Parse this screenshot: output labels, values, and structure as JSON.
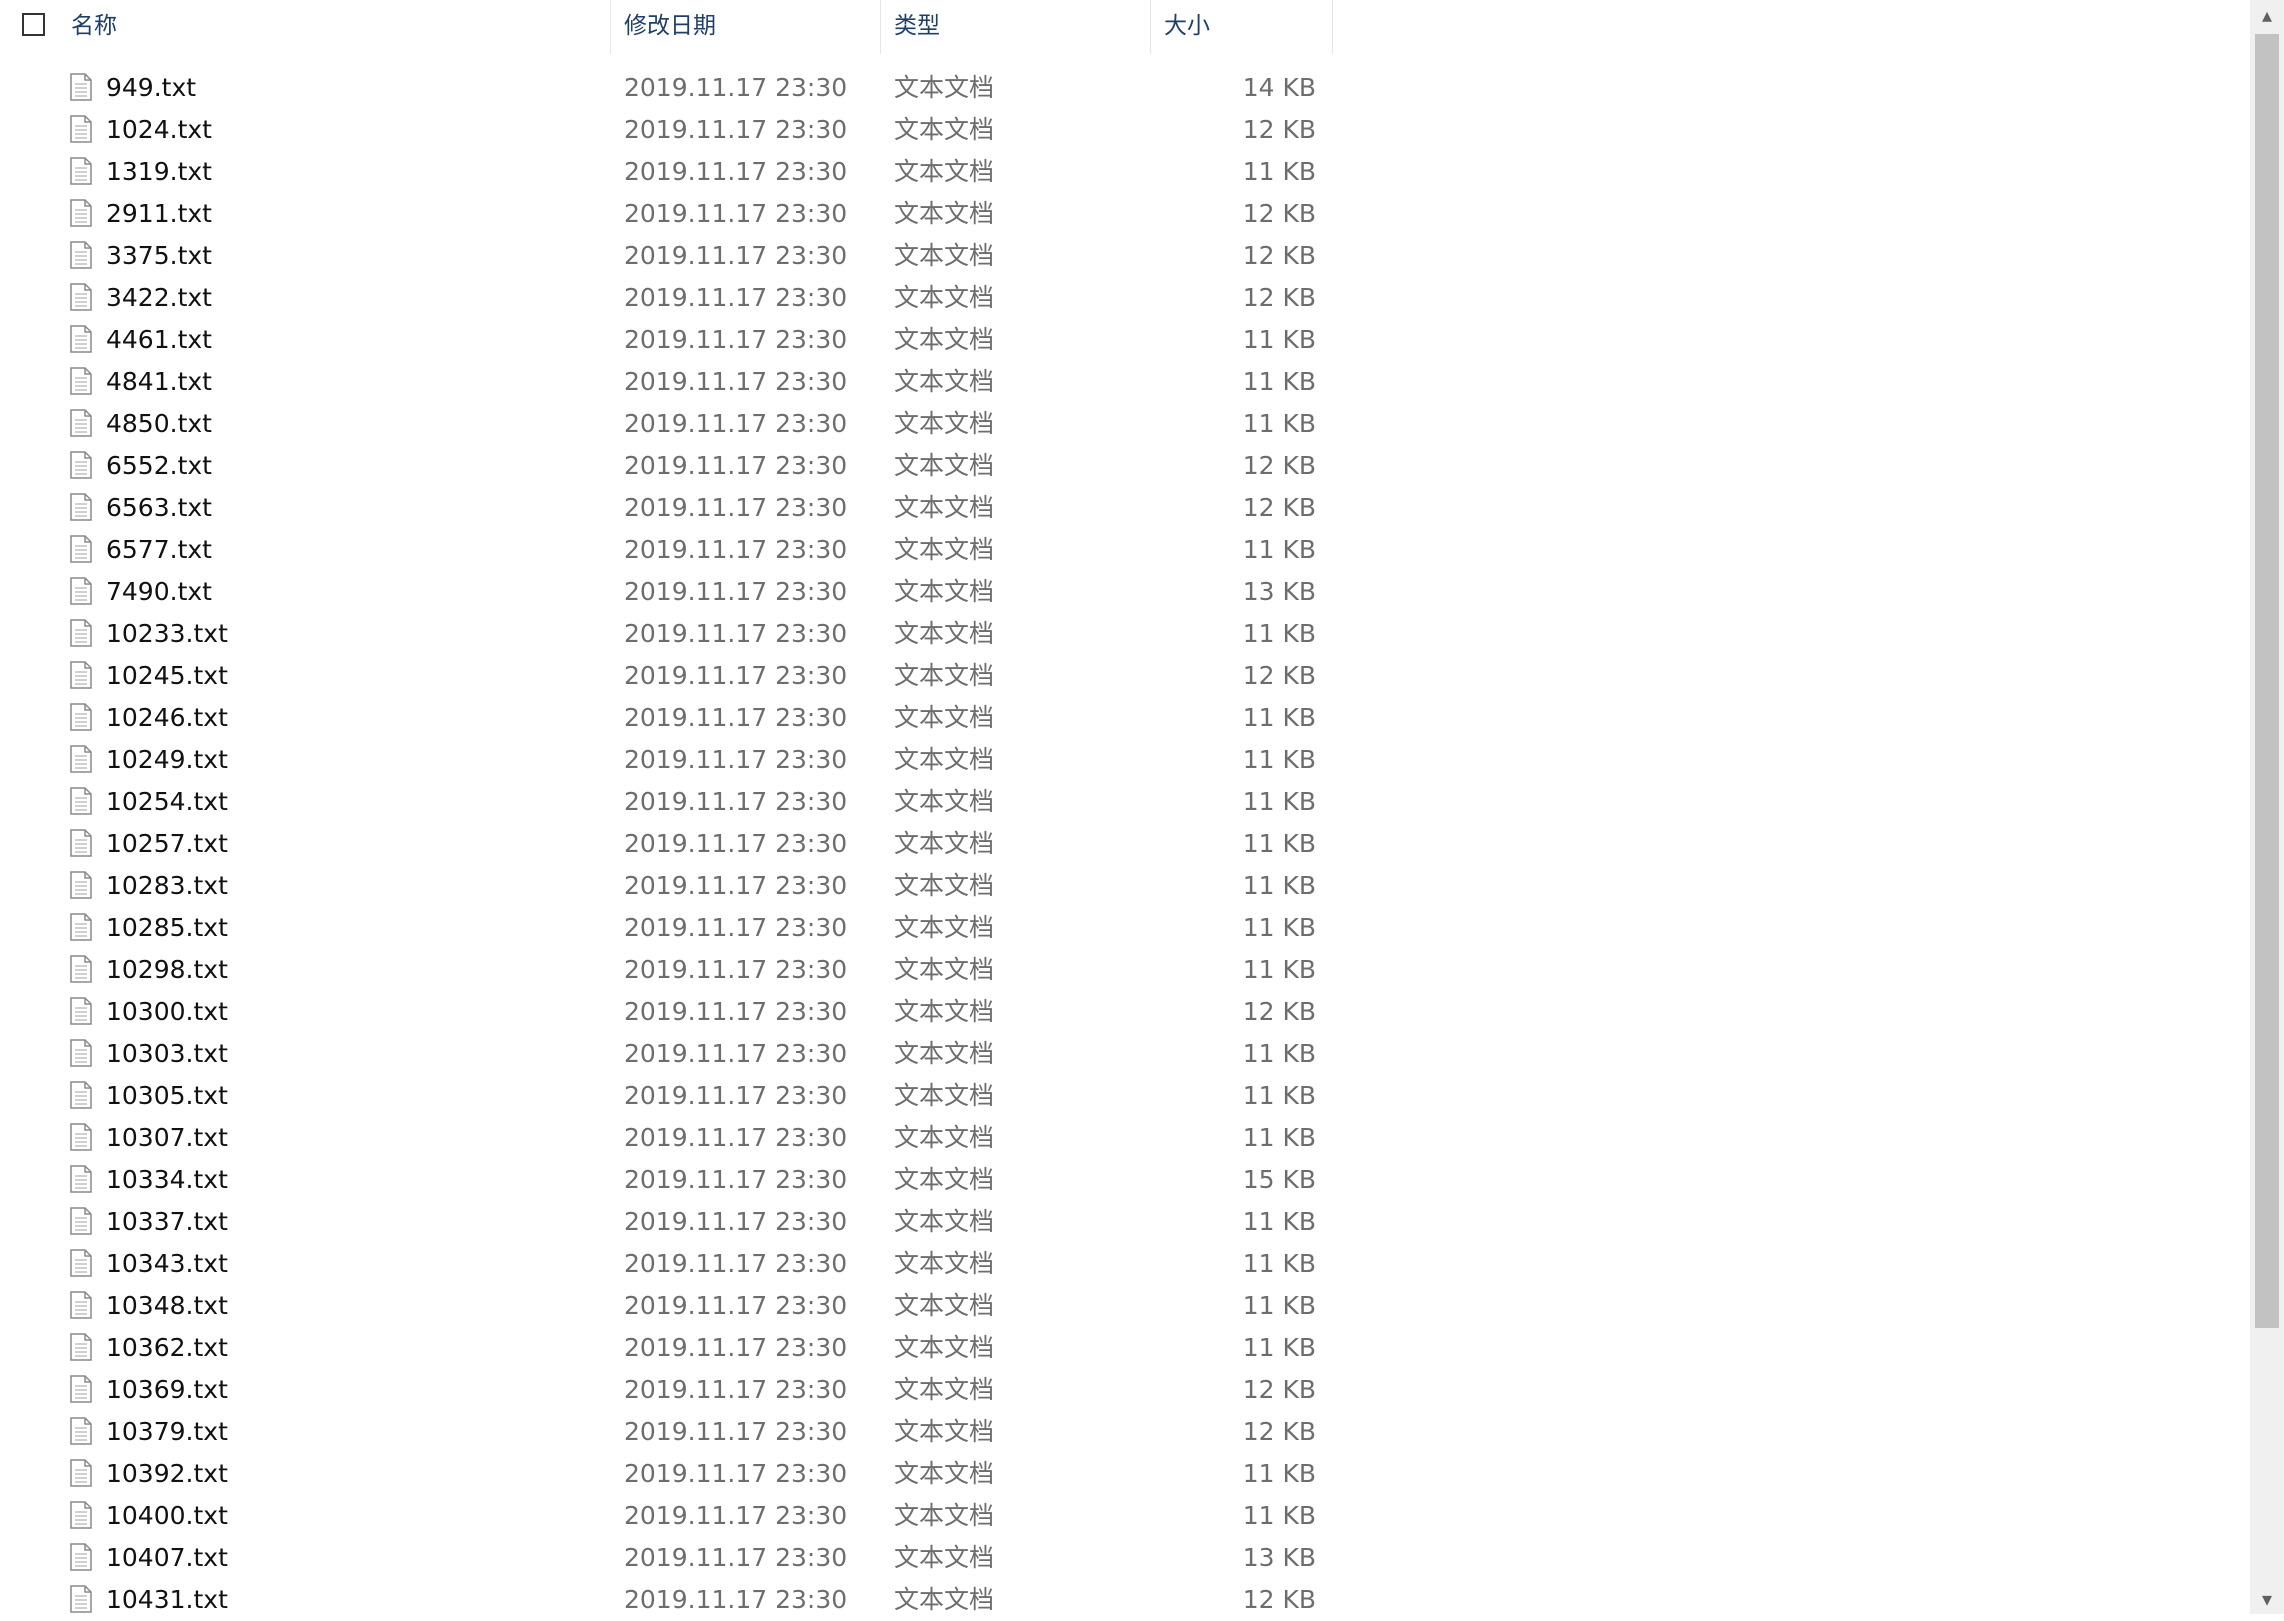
{
  "header": {
    "name": "名称",
    "date": "修改日期",
    "type": "类型",
    "size": "大小"
  },
  "files": [
    {
      "name": "949.txt",
      "date": "2019.11.17 23:30",
      "type": "文本文档",
      "size": "14 KB"
    },
    {
      "name": "1024.txt",
      "date": "2019.11.17 23:30",
      "type": "文本文档",
      "size": "12 KB"
    },
    {
      "name": "1319.txt",
      "date": "2019.11.17 23:30",
      "type": "文本文档",
      "size": "11 KB"
    },
    {
      "name": "2911.txt",
      "date": "2019.11.17 23:30",
      "type": "文本文档",
      "size": "12 KB"
    },
    {
      "name": "3375.txt",
      "date": "2019.11.17 23:30",
      "type": "文本文档",
      "size": "12 KB"
    },
    {
      "name": "3422.txt",
      "date": "2019.11.17 23:30",
      "type": "文本文档",
      "size": "12 KB"
    },
    {
      "name": "4461.txt",
      "date": "2019.11.17 23:30",
      "type": "文本文档",
      "size": "11 KB"
    },
    {
      "name": "4841.txt",
      "date": "2019.11.17 23:30",
      "type": "文本文档",
      "size": "11 KB"
    },
    {
      "name": "4850.txt",
      "date": "2019.11.17 23:30",
      "type": "文本文档",
      "size": "11 KB"
    },
    {
      "name": "6552.txt",
      "date": "2019.11.17 23:30",
      "type": "文本文档",
      "size": "12 KB"
    },
    {
      "name": "6563.txt",
      "date": "2019.11.17 23:30",
      "type": "文本文档",
      "size": "12 KB"
    },
    {
      "name": "6577.txt",
      "date": "2019.11.17 23:30",
      "type": "文本文档",
      "size": "11 KB"
    },
    {
      "name": "7490.txt",
      "date": "2019.11.17 23:30",
      "type": "文本文档",
      "size": "13 KB"
    },
    {
      "name": "10233.txt",
      "date": "2019.11.17 23:30",
      "type": "文本文档",
      "size": "11 KB"
    },
    {
      "name": "10245.txt",
      "date": "2019.11.17 23:30",
      "type": "文本文档",
      "size": "12 KB"
    },
    {
      "name": "10246.txt",
      "date": "2019.11.17 23:30",
      "type": "文本文档",
      "size": "11 KB"
    },
    {
      "name": "10249.txt",
      "date": "2019.11.17 23:30",
      "type": "文本文档",
      "size": "11 KB"
    },
    {
      "name": "10254.txt",
      "date": "2019.11.17 23:30",
      "type": "文本文档",
      "size": "11 KB"
    },
    {
      "name": "10257.txt",
      "date": "2019.11.17 23:30",
      "type": "文本文档",
      "size": "11 KB"
    },
    {
      "name": "10283.txt",
      "date": "2019.11.17 23:30",
      "type": "文本文档",
      "size": "11 KB"
    },
    {
      "name": "10285.txt",
      "date": "2019.11.17 23:30",
      "type": "文本文档",
      "size": "11 KB"
    },
    {
      "name": "10298.txt",
      "date": "2019.11.17 23:30",
      "type": "文本文档",
      "size": "11 KB"
    },
    {
      "name": "10300.txt",
      "date": "2019.11.17 23:30",
      "type": "文本文档",
      "size": "12 KB"
    },
    {
      "name": "10303.txt",
      "date": "2019.11.17 23:30",
      "type": "文本文档",
      "size": "11 KB"
    },
    {
      "name": "10305.txt",
      "date": "2019.11.17 23:30",
      "type": "文本文档",
      "size": "11 KB"
    },
    {
      "name": "10307.txt",
      "date": "2019.11.17 23:30",
      "type": "文本文档",
      "size": "11 KB"
    },
    {
      "name": "10334.txt",
      "date": "2019.11.17 23:30",
      "type": "文本文档",
      "size": "15 KB"
    },
    {
      "name": "10337.txt",
      "date": "2019.11.17 23:30",
      "type": "文本文档",
      "size": "11 KB"
    },
    {
      "name": "10343.txt",
      "date": "2019.11.17 23:30",
      "type": "文本文档",
      "size": "11 KB"
    },
    {
      "name": "10348.txt",
      "date": "2019.11.17 23:30",
      "type": "文本文档",
      "size": "11 KB"
    },
    {
      "name": "10362.txt",
      "date": "2019.11.17 23:30",
      "type": "文本文档",
      "size": "11 KB"
    },
    {
      "name": "10369.txt",
      "date": "2019.11.17 23:30",
      "type": "文本文档",
      "size": "12 KB"
    },
    {
      "name": "10379.txt",
      "date": "2019.11.17 23:30",
      "type": "文本文档",
      "size": "12 KB"
    },
    {
      "name": "10392.txt",
      "date": "2019.11.17 23:30",
      "type": "文本文档",
      "size": "11 KB"
    },
    {
      "name": "10400.txt",
      "date": "2019.11.17 23:30",
      "type": "文本文档",
      "size": "11 KB"
    },
    {
      "name": "10407.txt",
      "date": "2019.11.17 23:30",
      "type": "文本文档",
      "size": "13 KB"
    },
    {
      "name": "10431.txt",
      "date": "2019.11.17 23:30",
      "type": "文本文档",
      "size": "12 KB"
    }
  ],
  "icons": {
    "file": "text-file-icon",
    "sort": "sort-ascending-icon",
    "scroll_up": "scroll-up-arrow-icon",
    "scroll_down": "scroll-down-arrow-icon"
  },
  "colors": {
    "header_text": "#1f3f6b",
    "name_text": "#111111",
    "meta_text": "#6d6d6d",
    "scroll_thumb": "#c2c2c2"
  }
}
